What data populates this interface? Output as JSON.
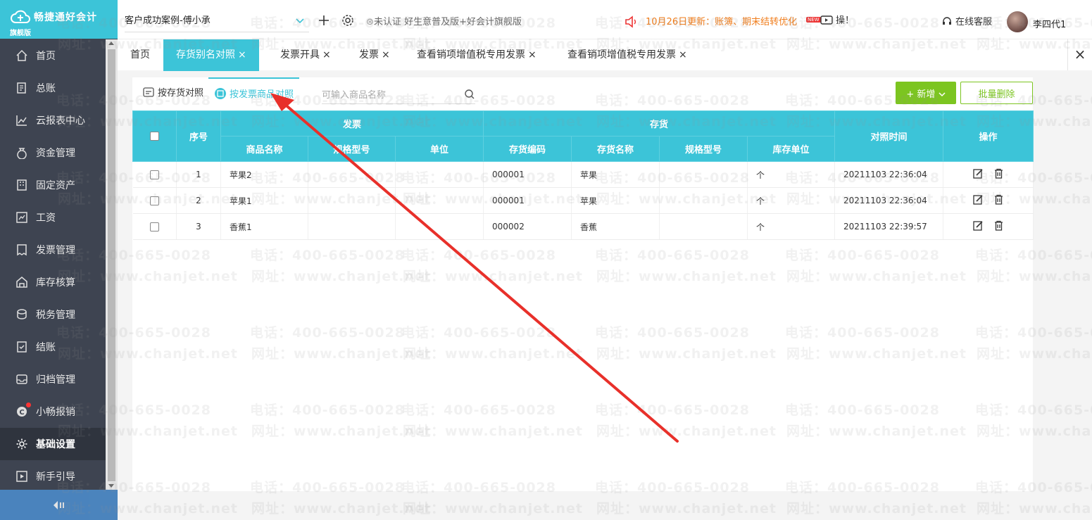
{
  "brand": {
    "name": "畅捷通好会计",
    "edition": "旗舰版"
  },
  "header": {
    "account": "客户成功案例-傅小承",
    "cert_status": "未认证",
    "cert_plan": "好生意普及版+好会计旗舰版",
    "notice": "10月26日更新：账簿、期末结转优化",
    "video_text": "操！",
    "new_badge": "NEW",
    "support": "在线客服",
    "user": "李四代1"
  },
  "sidebar": {
    "items": [
      {
        "label": "首页",
        "icon": "home-icon"
      },
      {
        "label": "总账",
        "icon": "ledger-icon"
      },
      {
        "label": "云报表中心",
        "icon": "chart-icon"
      },
      {
        "label": "资金管理",
        "icon": "money-bag-icon"
      },
      {
        "label": "固定资产",
        "icon": "building-icon"
      },
      {
        "label": "工资",
        "icon": "salary-icon"
      },
      {
        "label": "发票管理",
        "icon": "invoice-icon"
      },
      {
        "label": "库存核算",
        "icon": "warehouse-icon"
      },
      {
        "label": "税务管理",
        "icon": "tax-icon"
      },
      {
        "label": "结账",
        "icon": "checkout-icon"
      },
      {
        "label": "归档管理",
        "icon": "archive-icon"
      },
      {
        "label": "小畅报销",
        "icon": "reimburse-icon"
      },
      {
        "label": "基础设置",
        "icon": "gear-icon"
      },
      {
        "label": "新手引导",
        "icon": "guide-icon"
      }
    ],
    "active_index": 12
  },
  "tabs": [
    {
      "label": "首页",
      "closable": false
    },
    {
      "label": "存货别名对照",
      "closable": true,
      "active": true
    },
    {
      "label": "发票开具",
      "closable": true
    },
    {
      "label": "发票",
      "closable": true
    },
    {
      "label": "查看销项增值税专用发票",
      "closable": true
    },
    {
      "label": "查看销项增值税专用发票",
      "closable": true
    }
  ],
  "subtabs": [
    {
      "label": "按存货对照"
    },
    {
      "label": "按发票商品对照",
      "active": true
    }
  ],
  "search": {
    "placeholder": "可输入商品名称",
    "value": ""
  },
  "actions": {
    "add": "+ 新增",
    "batch_delete": "批量删除"
  },
  "table": {
    "group_headers": {
      "invoice": "发票",
      "inventory": "存货"
    },
    "headers": {
      "index": "序号",
      "goods_name": "商品名称",
      "spec": "规格型号",
      "unit": "单位",
      "inv_code": "存货编码",
      "inv_name": "存货名称",
      "inv_spec": "规格型号",
      "inv_unit": "库存单位",
      "time": "对照时间",
      "ops": "操作"
    },
    "rows": [
      {
        "index": "1",
        "goods_name": "苹果2",
        "spec": "",
        "unit": "",
        "inv_code": "000001",
        "inv_name": "苹果",
        "inv_spec": "",
        "inv_unit": "个",
        "time": "20211103 22:36:04"
      },
      {
        "index": "2",
        "goods_name": "苹果1",
        "spec": "",
        "unit": "",
        "inv_code": "000001",
        "inv_name": "苹果",
        "inv_spec": "",
        "inv_unit": "个",
        "time": "20211103 22:36:04"
      },
      {
        "index": "3",
        "goods_name": "香蕉1",
        "spec": "",
        "unit": "",
        "inv_code": "000002",
        "inv_name": "香蕉",
        "inv_spec": "",
        "inv_unit": "个",
        "time": "20211103 22:39:57"
      }
    ]
  },
  "watermark": {
    "phone": "电话：400-665-0028",
    "site": "网址：www.chanjet.net"
  },
  "colors": {
    "accent": "#3cc4d8",
    "sidebar": "#3e4451",
    "green": "#7cc520",
    "annotation": "#e8302a"
  }
}
